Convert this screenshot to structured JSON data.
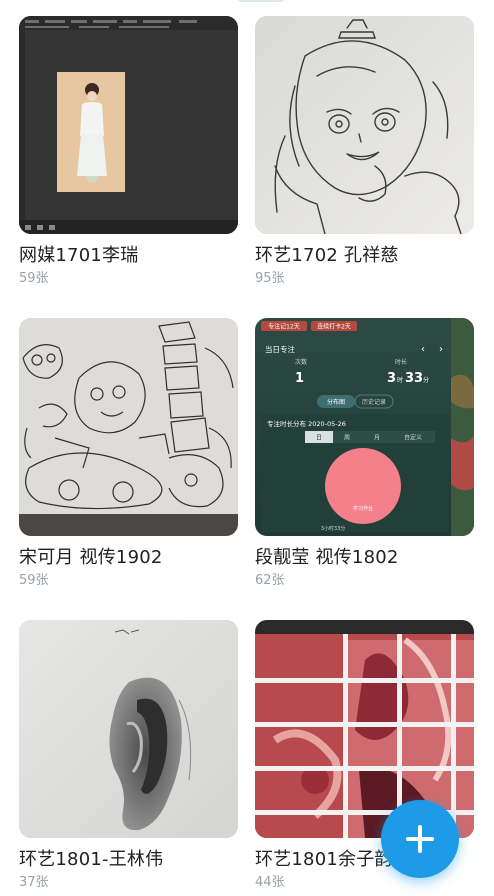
{
  "albums": [
    {
      "title": "网媒1701李瑞",
      "count": "59张",
      "thumb_icon": "photoshop-figure-painting-thumbnail"
    },
    {
      "title": "环艺1702 孔祥慈",
      "count": "95张",
      "thumb_icon": "girl-sketch-thumbnail"
    },
    {
      "title": "宋可月 视传1902",
      "count": "59张",
      "thumb_icon": "line-art-illustration-thumbnail"
    },
    {
      "title": "段靓莹 视传1802",
      "count": "62张",
      "thumb_icon": "focus-timer-screenshot-thumbnail"
    },
    {
      "title": "环艺1801-王林伟",
      "count": "37张",
      "thumb_icon": "ear-pencil-drawing-thumbnail"
    },
    {
      "title": "环艺1801余子韵",
      "count": "44张",
      "thumb_icon": "red-collage-thumbnail"
    }
  ],
  "focus_app": {
    "badge1": "专注记12天",
    "badge2": "连续打卡2天",
    "today_label": "当日专注",
    "times_label": "次数",
    "times_value": "1",
    "duration_label": "时长",
    "duration_value": "3",
    "duration_unit": "时",
    "duration_minutes": "33",
    "duration_min_unit": "分",
    "tab_distribution": "分布图",
    "tab_history": "历史记录",
    "dist_title": "专注时长分布 2020-05-26",
    "period_day": "日",
    "period_week": "周",
    "period_month": "月",
    "period_custom": "自定义",
    "pie_label": "学习作业",
    "pie_total": "3小时33分"
  },
  "fab": {
    "icon": "plus-icon",
    "color": "#1e9be8"
  },
  "colors": {
    "title": "#222222",
    "count": "#9aa0a6",
    "accent": "#1e9be8"
  }
}
